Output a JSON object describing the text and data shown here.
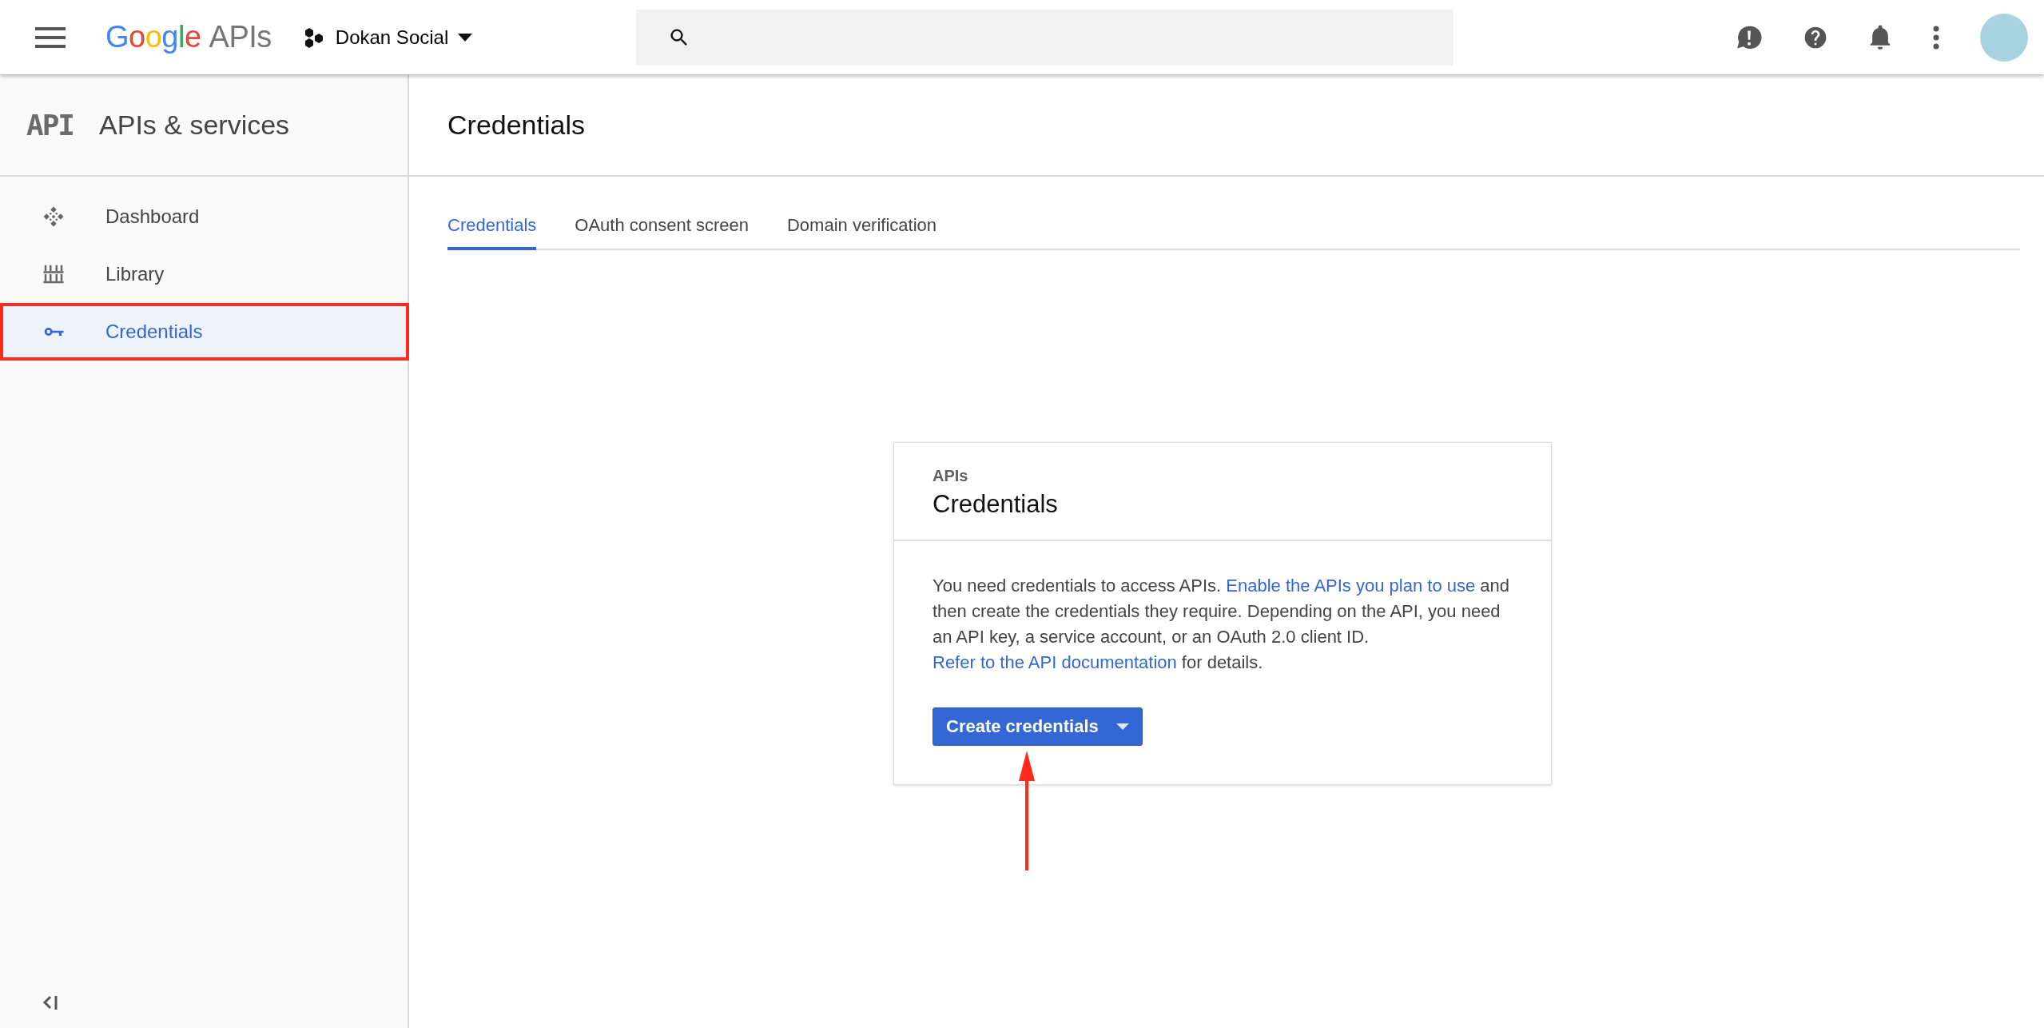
{
  "topbar": {
    "logo": "Google",
    "product": "APIs",
    "project": "Dokan Social"
  },
  "sidebar": {
    "badge": "API",
    "title": "APIs & services",
    "items": [
      {
        "label": "Dashboard",
        "kind": "dashboard",
        "selected": false,
        "outlined": false
      },
      {
        "label": "Library",
        "kind": "library",
        "selected": false,
        "outlined": false
      },
      {
        "label": "Credentials",
        "kind": "key",
        "selected": true,
        "outlined": true
      }
    ]
  },
  "page": {
    "title": "Credentials",
    "tabs": [
      {
        "label": "Credentials",
        "selected": true
      },
      {
        "label": "OAuth consent screen",
        "selected": false
      },
      {
        "label": "Domain verification",
        "selected": false
      }
    ]
  },
  "card": {
    "overline": "APIs",
    "title": "Credentials",
    "text": [
      {
        "kind": "plain",
        "text": "You need credentials to access APIs. "
      },
      {
        "kind": "link",
        "text": "Enable the APIs you plan to use"
      },
      {
        "kind": "plain",
        "text": " and then create the credentials they require. Depending on the API, you need an API key, a service account, or an OAuth 2.0 client ID. "
      },
      {
        "kind": "link",
        "text": "Refer to the API documentation"
      },
      {
        "kind": "plain",
        "text": " for details."
      }
    ],
    "button": {
      "label": "Create credentials",
      "pointed_at": true
    }
  }
}
